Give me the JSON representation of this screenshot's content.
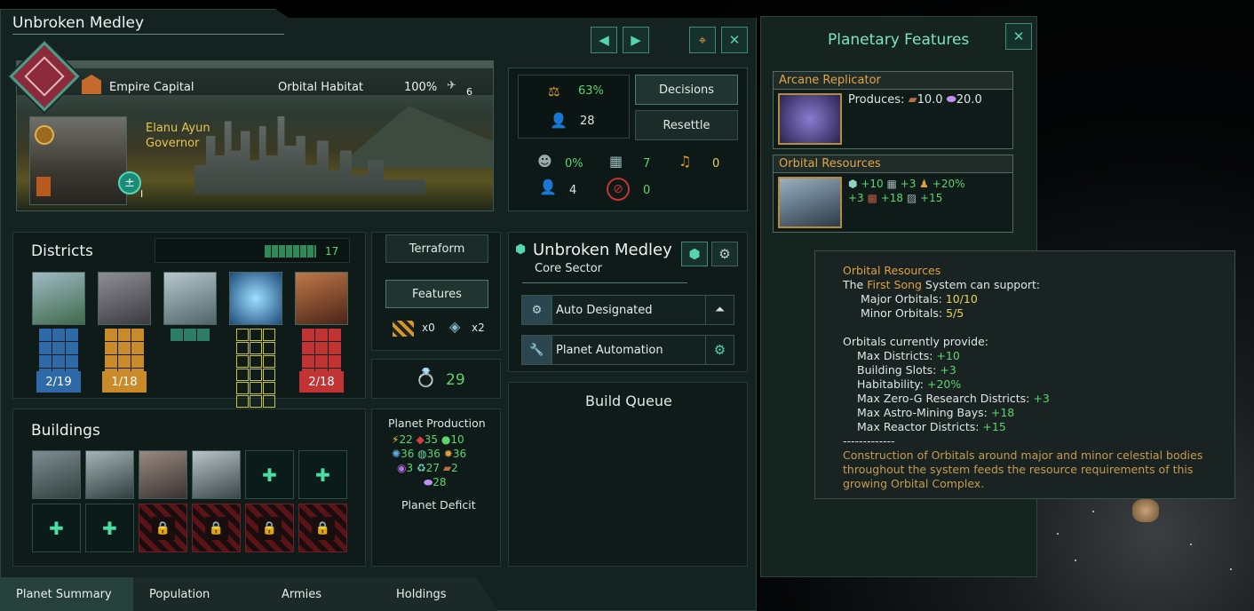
{
  "window": {
    "title": "Unbroken Medley"
  },
  "nav": {
    "prev": "◀",
    "next": "▶"
  },
  "header": {
    "empire_capital": "Empire Capital",
    "planet_type": "Orbital Habitat",
    "habitability": "100%",
    "ships_count": "6",
    "governor_name": "Elanu Ayun",
    "governor_role": "Governor",
    "governor_level": "I"
  },
  "stats": {
    "stability": "63%",
    "pops": "28",
    "decisions_label": "Decisions",
    "resettle_label": "Resettle",
    "crime": "0%",
    "housing": "7",
    "amenities": "0",
    "unemployed": "4",
    "blocked": "0"
  },
  "districts": {
    "title": "Districts",
    "count": "17",
    "items": [
      {
        "label": "2/19",
        "color": "#2f6aa8"
      },
      {
        "label": "1/18",
        "color": "#c98a2a"
      },
      {
        "label": "",
        "color": "#3aa68a"
      },
      {
        "label": "",
        "color": "#c8c43a"
      },
      {
        "label": "2/18",
        "color": "#c23434"
      }
    ]
  },
  "middle": {
    "terraform_label": "Terraform",
    "features_label": "Features",
    "blockers_count": "x0",
    "features_count": "x2",
    "amenity_value": "29"
  },
  "sector": {
    "planet_name": "Unbroken Medley",
    "sector_name": "Core Sector",
    "auto_designated": "Auto Designated",
    "planet_automation": "Planet Automation"
  },
  "buildings": {
    "title": "Buildings"
  },
  "production": {
    "title": "Planet Production",
    "energy": "22",
    "minerals": "35",
    "food": "10",
    "physics": "36",
    "society": "36",
    "engineering": "36",
    "unity": "3",
    "consumer_goods": "27",
    "alloys": "2",
    "exotic": "28",
    "deficit_title": "Planet Deficit"
  },
  "build_queue": {
    "title": "Build Queue"
  },
  "features_panel": {
    "title": "Planetary Features",
    "cards": [
      {
        "name": "Arcane Replicator",
        "produces_label": "Produces:",
        "val1": "10.0",
        "val2": "20.0"
      },
      {
        "name": "Orbital Resources",
        "line1": "+10",
        "line1b": "+3",
        "line1c": "+20%",
        "line2a": "+3",
        "line2b": "+18",
        "line2c": "+15"
      }
    ]
  },
  "tooltip": {
    "title": "Orbital Resources",
    "l1_pre": "The ",
    "l1_sys": "First Song",
    "l1_post": " System can support:",
    "major_label": "Major Orbitals: ",
    "major_val": "10/10",
    "minor_label": "Minor Orbitals: ",
    "minor_val": "5/5",
    "provide": "Orbitals currently provide:",
    "rows": [
      {
        "label": "Max Districts: ",
        "val": "+10"
      },
      {
        "label": "Building Slots: ",
        "val": "+3"
      },
      {
        "label": "Habitability: ",
        "val": "+20%"
      },
      {
        "label": "Max Zero-G Research Districts: ",
        "val": "+3"
      },
      {
        "label": "Max Astro-Mining Bays: ",
        "val": "+18"
      },
      {
        "label": "Max Reactor Districts: ",
        "val": "+15"
      }
    ],
    "sep": "-------------",
    "desc": "Construction of Orbitals around major and minor celestial bodies throughout the system feeds the resource requirements of this growing Orbital Complex."
  },
  "tabs": [
    "Planet Summary",
    "Population",
    "Armies",
    "Holdings"
  ]
}
